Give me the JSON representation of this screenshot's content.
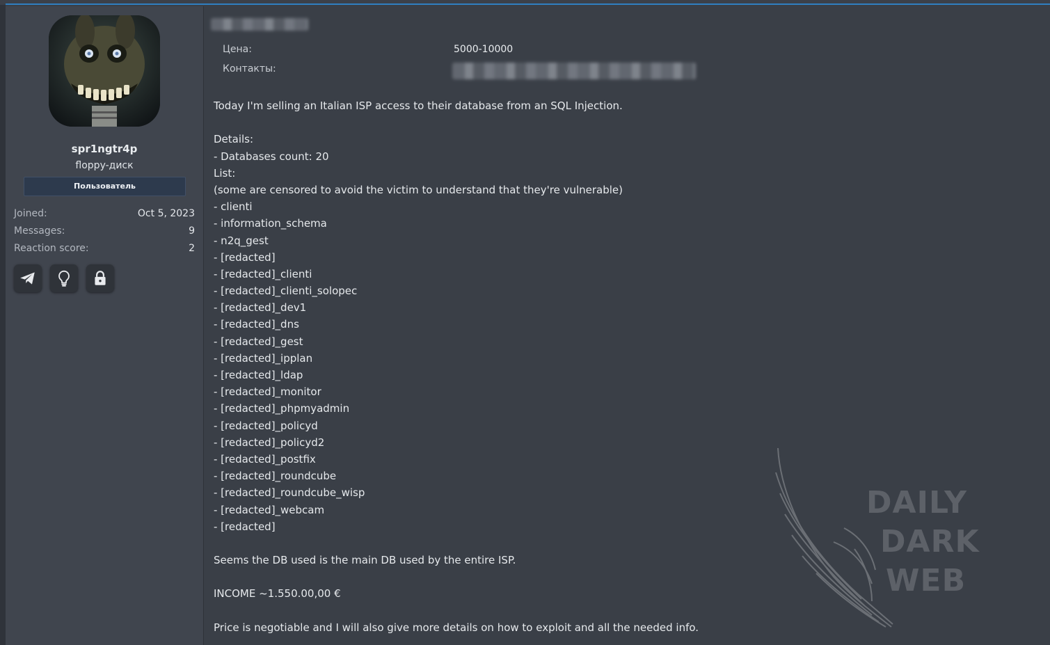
{
  "user": {
    "name": "spr1ngtr4p",
    "title": "floppy-диск",
    "group": "Пользователь",
    "stats": [
      {
        "label": "Joined:",
        "value": "Oct 5, 2023"
      },
      {
        "label": "Messages:",
        "value": "9"
      },
      {
        "label": "Reaction score:",
        "value": "2"
      }
    ],
    "contact_icons": [
      "telegram-icon",
      "lightbulb-icon",
      "lock-icon"
    ]
  },
  "post": {
    "fields": [
      {
        "label": "Цена:",
        "value": "5000-10000"
      },
      {
        "label": "Контакты:",
        "value": ""
      }
    ],
    "lines": [
      "Today I'm selling an Italian ISP access to their database from an SQL Injection.",
      "",
      "Details:",
      "- Databases count: 20",
      "List:",
      "(some are censored to avoid the victim to understand that they're vulnerable)",
      "- clienti",
      "- information_schema",
      "- n2q_gest",
      "- [redacted]",
      "- [redacted]_clienti",
      "- [redacted]_clienti_solopec",
      "- [redacted]_dev1",
      "- [redacted]_dns",
      "- [redacted]_gest",
      "- [redacted]_ipplan",
      "- [redacted]_ldap",
      "- [redacted]_monitor",
      "- [redacted]_phpmyadmin",
      "- [redacted]_policyd",
      "- [redacted]_policyd2",
      "- [redacted]_postfix",
      "- [redacted]_roundcube",
      "- [redacted]_roundcube_wisp",
      "- [redacted]_webcam",
      "- [redacted]",
      "",
      "Seems the DB used is the main DB used by the entire ISP.",
      "",
      "INCOME ~1.550.00,00 €",
      "",
      "Price is negotiable and I will also give more details on how to exploit and all the needed info."
    ]
  },
  "watermark": {
    "line1": "DAILY",
    "line2": "DARK",
    "line3": "WEB"
  }
}
